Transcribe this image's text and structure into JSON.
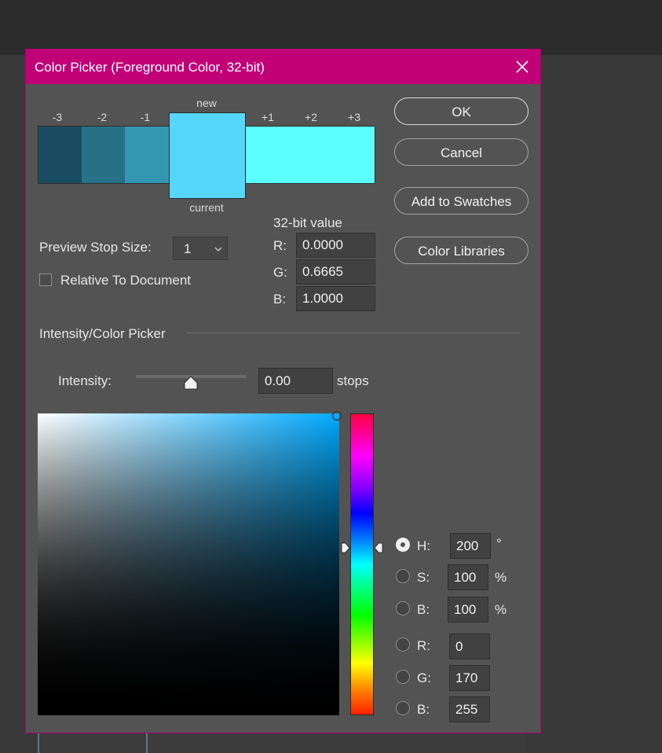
{
  "dialog": {
    "title": "Color Picker (Foreground Color, 32-bit)"
  },
  "swatches": {
    "new_label": "new",
    "current_label": "current",
    "steps": [
      "-3",
      "-2",
      "-1",
      "+1",
      "+2",
      "+3"
    ],
    "colors": {
      "m3": "#1a4c61",
      "m2": "#277186",
      "m1": "#3497b1",
      "new": "#55d6fd",
      "p1": "#5bffff"
    }
  },
  "buttons": {
    "ok": "OK",
    "cancel": "Cancel",
    "add_to_swatches": "Add to Swatches",
    "color_libraries": "Color Libraries"
  },
  "preview": {
    "stop_size_label": "Preview Stop Size:",
    "stop_size_value": "1",
    "relative_label": "Relative To Document"
  },
  "value32": {
    "title": "32-bit value",
    "r_label": "R:",
    "r": "0.0000",
    "g_label": "G:",
    "g": "0.6665",
    "b_label": "B:",
    "b": "1.0000"
  },
  "intensity": {
    "section_title": "Intensity/Color Picker",
    "label": "Intensity:",
    "value": "0.00",
    "unit": "stops",
    "slider_level": 0.5
  },
  "hsb_rgb": {
    "h_label": "H:",
    "h": "200",
    "h_unit": "°",
    "s_label": "S:",
    "s": "100",
    "s_unit": "%",
    "bb_label": "B:",
    "bb": "100",
    "bb_unit": "%",
    "r_label": "R:",
    "r": "0",
    "g_label": "G:",
    "g": "170",
    "b_label": "B:",
    "b": "255"
  },
  "colors": {
    "title_bar": "#c10078",
    "dialog_bg": "#535353",
    "selected_color": "#00aaff"
  }
}
